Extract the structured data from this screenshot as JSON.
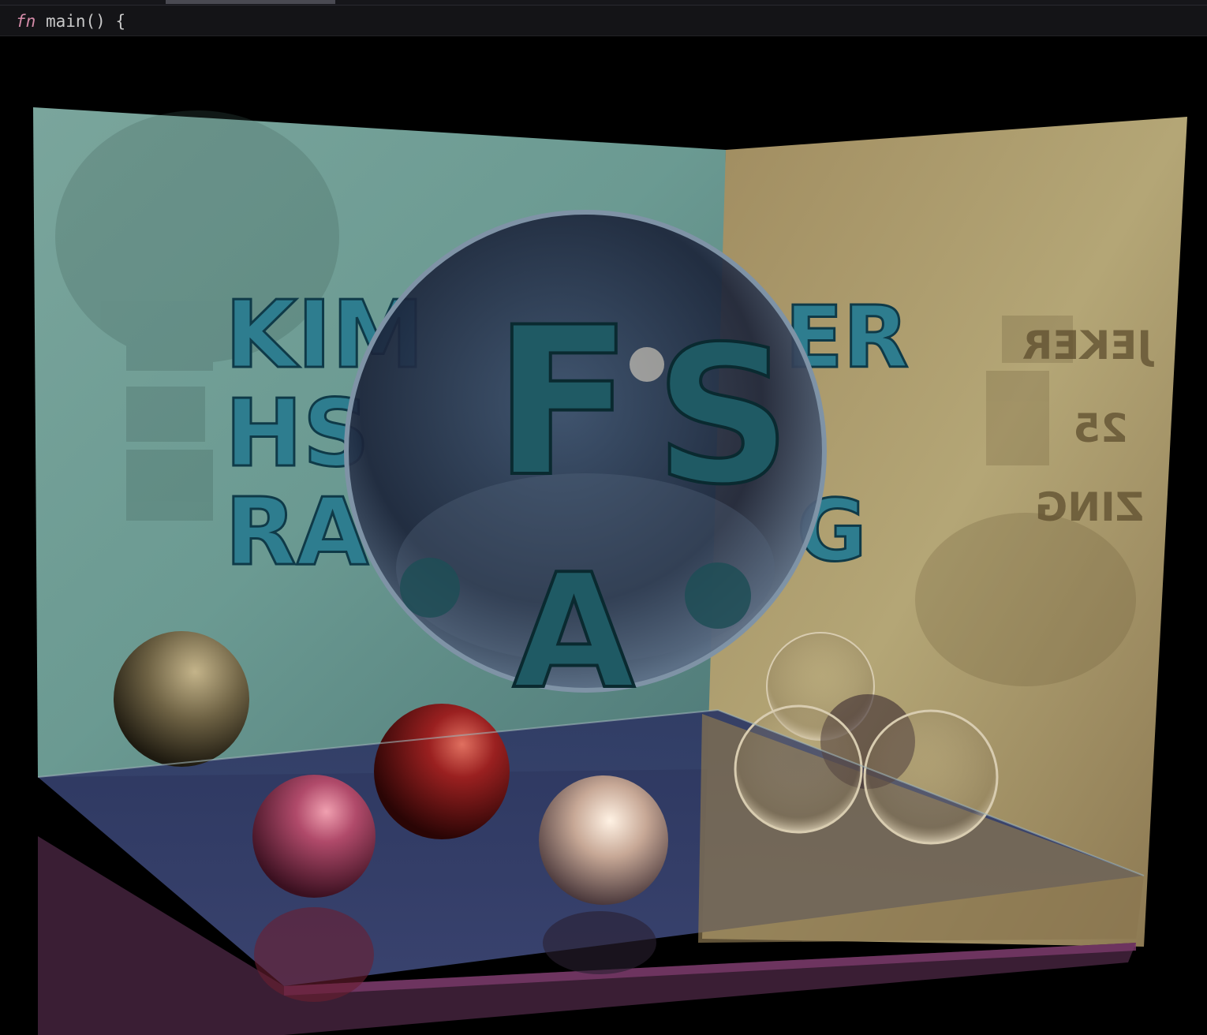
{
  "editor": {
    "code_line": {
      "keyword": "fn",
      "rest": " main() {"
    },
    "colors": {
      "keyword": "#d48ba8",
      "code_text": "#c8c8c8",
      "bar_bg": "#141417"
    }
  },
  "scene": {
    "wall_text_left": {
      "line1": "KIM",
      "line2": "HS",
      "line3": "RA"
    },
    "wall_text_right": {
      "line1": "ER",
      "line2": "G"
    },
    "sphere_letters": {
      "top": "F",
      "right": "S",
      "bottom": "A"
    },
    "mirror_text": {
      "line1": "JEKER",
      "line2": "25",
      "line3": "ZING"
    },
    "colors": {
      "left_wall": "#6f9c95",
      "right_wall": "#a89868",
      "floor": "#3f4a78",
      "text_3d": "#2e7d8f",
      "red_ball": "#8a1c1c",
      "pink_ball": "#b04a6a",
      "gold_ball": "#8a7a55",
      "pearl_ball": "#d9c3b0"
    }
  }
}
